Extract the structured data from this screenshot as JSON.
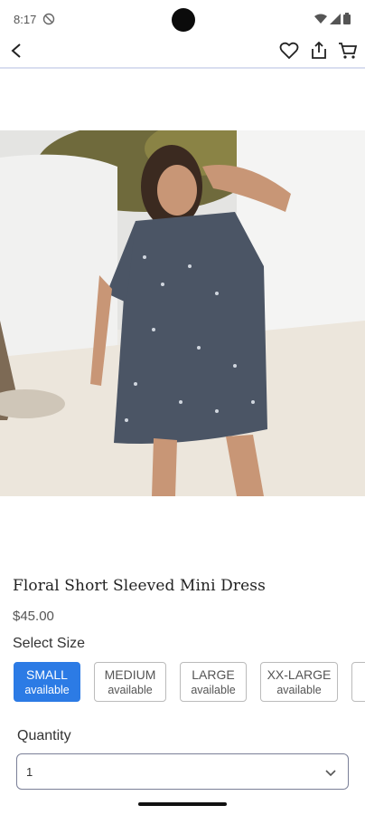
{
  "status_bar": {
    "time": "8:17"
  },
  "app_bar": {
    "back_icon": "arrow-back-icon",
    "actions": [
      "heart-icon",
      "share-icon",
      "cart-icon"
    ]
  },
  "product": {
    "image_alt": "Woman in floral dress",
    "title": "Floral Short Sleeved Mini Dress",
    "price": "$45.00"
  },
  "size_selector": {
    "label": "Select Size",
    "options": [
      {
        "size": "SMALL",
        "availability": "available",
        "selected": true
      },
      {
        "size": "MEDIUM",
        "availability": "available",
        "selected": false
      },
      {
        "size": "LARGE",
        "availability": "available",
        "selected": false
      },
      {
        "size": "XX-LARGE",
        "availability": "available",
        "selected": false
      }
    ]
  },
  "quantity": {
    "label": "Quantity",
    "value": "1"
  },
  "colors": {
    "accent": "#2c7be5",
    "divider": "#d9def0"
  }
}
